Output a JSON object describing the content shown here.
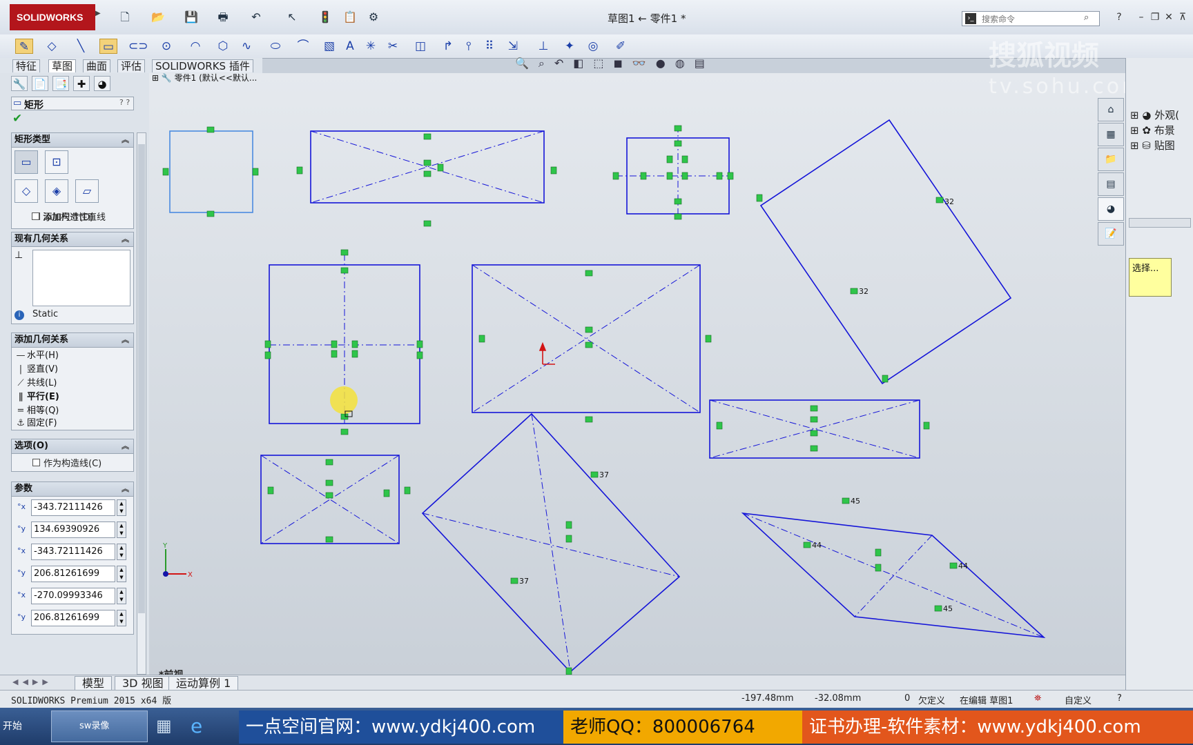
{
  "app": {
    "logo_text": "SOLIDWORKS",
    "window_title": "草图1 ← 零件1 *",
    "search_placeholder": "搜索命令"
  },
  "tabs": [
    "特征",
    "草图",
    "曲面",
    "评估",
    "SOLIDWORKS 插件"
  ],
  "active_tab": "草图",
  "feature_tree_breadcrumb": "零件1   (默认<<默认...",
  "property_manager": {
    "title": "矩形",
    "rect_type": {
      "header": "矩形类型",
      "add_dimension": "添加尺寸(D)",
      "add_construction": "添加构造性直线"
    },
    "existing_relations": {
      "header": "现有几何关系",
      "status": "Static"
    },
    "add_relations": {
      "header": "添加几何关系",
      "items": [
        "水平(H)",
        "竖直(V)",
        "共线(L)",
        "平行(E)",
        "相等(Q)",
        "固定(F)"
      ],
      "bold_item": "平行(E)"
    },
    "options": {
      "header": "选项(O)",
      "construction": "作为构造线(C)"
    },
    "params": {
      "header": "参数",
      "values": [
        "-343.72111426",
        "134.69390926",
        "-343.72111426",
        "206.81261699",
        "-270.09993346",
        "206.81261699"
      ]
    }
  },
  "canvas": {
    "view_label": "*前视",
    "dim_labels": [
      "32",
      "32",
      "37",
      "37",
      "45",
      "44",
      "44",
      "45"
    ],
    "triad_x": "X",
    "triad_y": "Y"
  },
  "bottom_tabs": [
    "模型",
    "3D 视图",
    "运动算例 1"
  ],
  "status": {
    "product": "SOLIDWORKS Premium 2015 x64 版",
    "x": "-197.48mm",
    "y": "-32.08mm",
    "z": "0",
    "defined": "欠定义",
    "editing": "在编辑 草图1",
    "custom": "自定义"
  },
  "right_panel": {
    "tree": [
      "外观(",
      "布景",
      "贴图"
    ],
    "select_note": "选择..."
  },
  "taskbar": {
    "start": "开始",
    "item": "sw录像",
    "banner1": "一点空间官网：www.ydkj400.com",
    "banner2": "老师QQ：800006764",
    "banner3": "证书办理-软件素材：www.ydkj400.com"
  },
  "watermark": {
    "line1": "搜狐视频",
    "line2": "tv.sohu.com"
  },
  "colors": {
    "sketch_line": "#1414d8",
    "relation_glyph": "#2fc54a",
    "logo_red": "#b3161c",
    "canvas_top": "#e5e9ee",
    "banner1": "#1f4f9a",
    "banner2": "#f2a800",
    "banner3": "#e2561c"
  }
}
